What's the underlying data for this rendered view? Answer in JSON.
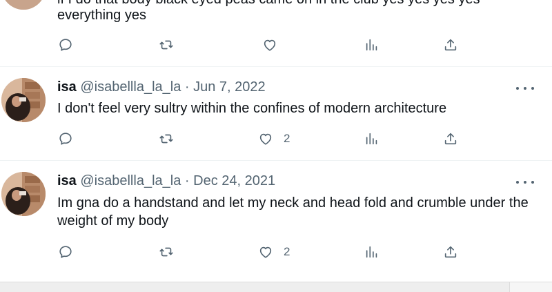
{
  "tweets": [
    {
      "name": "",
      "handle": "",
      "separator": "",
      "date": "",
      "partial_line": "if I do that body black eyed peas came on in the club yes yes yes yes",
      "text": "everything yes",
      "likes": "",
      "has_more": false
    },
    {
      "name": "isa",
      "handle": "@isabellla_la_la",
      "separator": "·",
      "date": "Jun 7, 2022",
      "text": "I don't feel very sultry within the confines of modern architecture",
      "likes": "2",
      "has_more": true
    },
    {
      "name": "isa",
      "handle": "@isabellla_la_la",
      "separator": "·",
      "date": "Dec 24, 2021",
      "text": "Im gna do a handstand and let my neck and head fold and crumble under the weight of my body",
      "likes": "2",
      "has_more": true
    }
  ],
  "icons": {
    "reply": "reply-icon",
    "retweet": "retweet-icon",
    "like": "heart-icon",
    "views": "views-icon",
    "share": "share-icon",
    "more": "more-icon"
  },
  "colors": {
    "icon": "#536471",
    "divider": "#eff3f4",
    "text": "#0f1419"
  }
}
